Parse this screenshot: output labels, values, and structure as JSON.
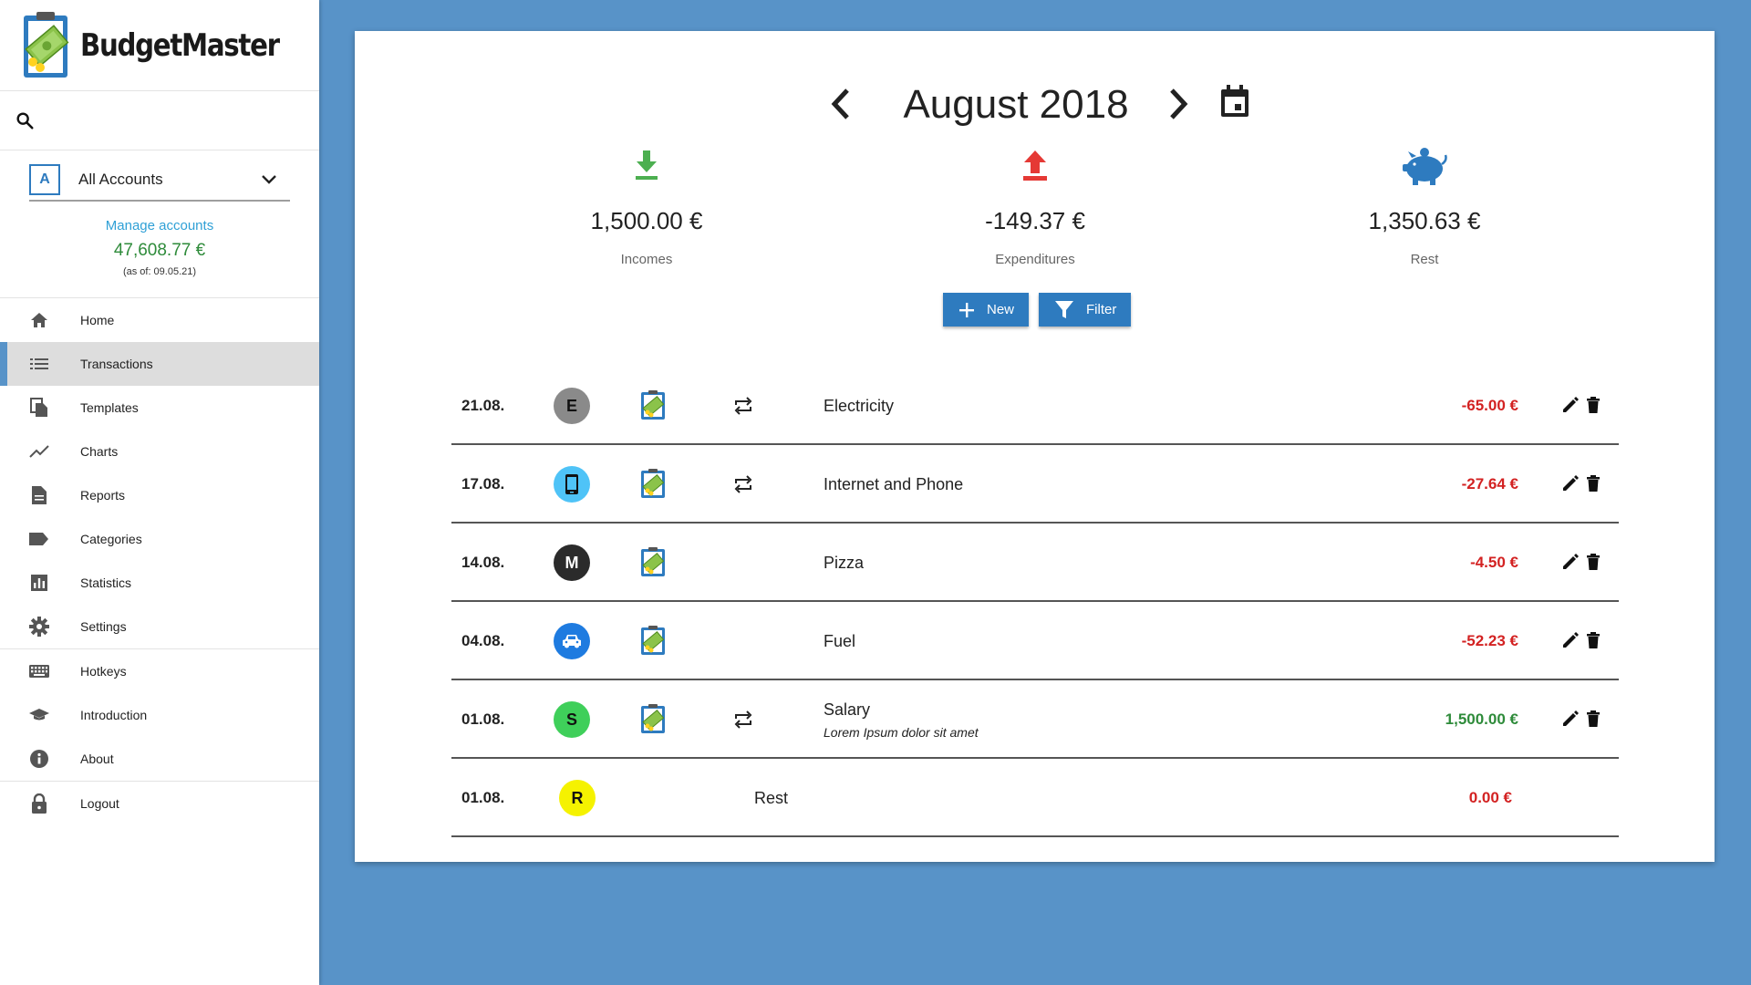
{
  "app": {
    "name": "BudgetMaster"
  },
  "account": {
    "badge": "A",
    "name": "All Accounts",
    "manage_label": "Manage accounts",
    "balance": "47,608.77 €",
    "as_of": "(as of: 09.05.21)"
  },
  "nav": {
    "items": [
      {
        "label": "Home",
        "icon": "home-icon"
      },
      {
        "label": "Transactions",
        "icon": "list-icon"
      },
      {
        "label": "Templates",
        "icon": "copy-icon"
      },
      {
        "label": "Charts",
        "icon": "chart-line-icon"
      },
      {
        "label": "Reports",
        "icon": "document-icon"
      },
      {
        "label": "Categories",
        "icon": "tag-icon"
      },
      {
        "label": "Statistics",
        "icon": "bar-chart-icon"
      },
      {
        "label": "Settings",
        "icon": "gear-icon"
      },
      {
        "label": "Hotkeys",
        "icon": "keyboard-icon"
      },
      {
        "label": "Introduction",
        "icon": "graduation-cap-icon"
      },
      {
        "label": "About",
        "icon": "info-icon"
      },
      {
        "label": "Logout",
        "icon": "lock-icon"
      }
    ]
  },
  "month": {
    "title": "August 2018"
  },
  "summary": {
    "incomes": {
      "value": "1,500.00 €",
      "label": "Incomes"
    },
    "expenditures": {
      "value": "-149.37 €",
      "label": "Expenditures"
    },
    "rest": {
      "value": "1,350.63 €",
      "label": "Rest"
    }
  },
  "buttons": {
    "new_label": "New",
    "filter_label": "Filter"
  },
  "colors": {
    "accent": "#2e7bbf",
    "background": "#5893c8",
    "negative": "#d32222",
    "positive": "#2e8b3a"
  },
  "transactions": [
    {
      "date": "21.08.",
      "category": "E",
      "category_color": "#8a8a8a",
      "category_text_color": "#111",
      "name": "Electricity",
      "description": "",
      "amount": "-65.00 €"
    },
    {
      "date": "17.08.",
      "category": "",
      "category_icon": "smartphone-icon",
      "category_color": "#4fc3f7",
      "name": "Internet and Phone",
      "description": "",
      "amount": "-27.64 €"
    },
    {
      "date": "14.08.",
      "category": "M",
      "category_color": "#2b2b2b",
      "category_text_color": "#fff",
      "name": "Pizza",
      "description": "",
      "amount": "-4.50 €"
    },
    {
      "date": "04.08.",
      "category": "",
      "category_icon": "car-icon",
      "category_color": "#1e7be0",
      "name": "Fuel",
      "description": "",
      "amount": "-52.23 €"
    },
    {
      "date": "01.08.",
      "category": "S",
      "category_color": "#3fcf5a",
      "category_text_color": "#111",
      "name": "Salary",
      "description": "Lorem Ipsum dolor sit amet",
      "amount": "1,500.00 €"
    },
    {
      "date": "01.08.",
      "category": "R",
      "category_color": "#f5f200",
      "category_text_color": "#111",
      "name": "Rest",
      "description": "",
      "amount": "0.00 €"
    }
  ]
}
